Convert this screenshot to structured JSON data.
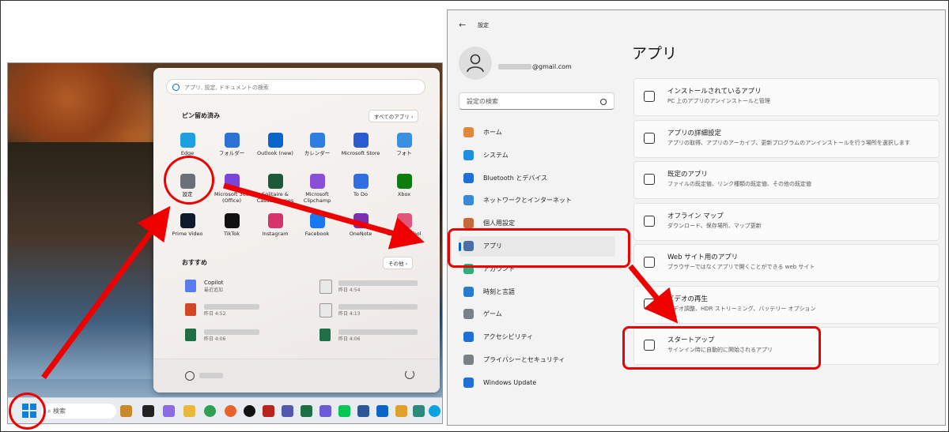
{
  "start_menu": {
    "search_placeholder": "アプリ, 設定, ドキュメントの検索",
    "pinned_heading": "ピン留め済み",
    "all_apps_label": "すべてのアプリ ›",
    "pinned_apps": [
      {
        "label": "Edge",
        "color": "#1ea0e0"
      },
      {
        "label": "フォルダー",
        "color": "#2a72d3"
      },
      {
        "label": "Outlook (new)",
        "color": "#0a64c9"
      },
      {
        "label": "カレンダー",
        "color": "#2f7de1"
      },
      {
        "label": "Microsoft Store",
        "color": "#2a5cd0"
      },
      {
        "label": "フォト",
        "color": "#3b8fe0"
      },
      {
        "label": "設定",
        "color": "#6b6f78"
      },
      {
        "label": "Microsoft 365 (Office)",
        "color": "#7b45d6"
      },
      {
        "label": "Solitaire & Casual Games",
        "color": "#1d5a3a"
      },
      {
        "label": "Microsoft Clipchamp",
        "color": "#8a4fd8"
      },
      {
        "label": "To Do",
        "color": "#2f6fe0"
      },
      {
        "label": "Xbox",
        "color": "#107c10"
      },
      {
        "label": "Prime Video",
        "color": "#0f1b2d"
      },
      {
        "label": "TikTok",
        "color": "#111111"
      },
      {
        "label": "Instagram",
        "color": "#d6336c"
      },
      {
        "label": "Facebook",
        "color": "#1877f2"
      },
      {
        "label": "OneNote",
        "color": "#7b2fb0"
      },
      {
        "label": "Snipping Tool",
        "color": "#e0567a"
      }
    ],
    "recommended_heading": "おすすめ",
    "more_label": "その他 ›",
    "recommended": [
      {
        "title": "Copilot",
        "sub": "最近追加",
        "color": "#5b7cf0"
      },
      {
        "title": "",
        "sub": "昨日 4:54",
        "color": "#e8e8e8"
      },
      {
        "title": "",
        "sub": "昨日 4:52",
        "color": "#d24726"
      },
      {
        "title": "",
        "sub": "昨日 4:13",
        "color": "#e8e8e8"
      },
      {
        "title": "",
        "sub": "昨日 4:06",
        "color": "#1d7044"
      },
      {
        "title": "",
        "sub": "昨日 4:06",
        "color": "#1d7044"
      }
    ]
  },
  "taskbar": {
    "search_placeholder": "検索"
  },
  "settings": {
    "window_title": "設定",
    "email": "@gmail.com",
    "search_placeholder": "設定の検索",
    "page_title": "アプリ",
    "nav": [
      {
        "label": "ホーム",
        "icon": "home-icon",
        "color": "#e0883c"
      },
      {
        "label": "システム",
        "icon": "system-icon",
        "color": "#1e8fe0"
      },
      {
        "label": "Bluetooth とデバイス",
        "icon": "bluetooth-icon",
        "color": "#1e6fd8"
      },
      {
        "label": "ネットワークとインターネット",
        "icon": "network-icon",
        "color": "#3b87dc"
      },
      {
        "label": "個人用設定",
        "icon": "personalization-icon",
        "color": "#c46a3a"
      },
      {
        "label": "アプリ",
        "icon": "apps-icon",
        "color": "#4a6fa5"
      },
      {
        "label": "アカウント",
        "icon": "account-icon",
        "color": "#2fae7a"
      },
      {
        "label": "時刻と言語",
        "icon": "time-language-icon",
        "color": "#2a7bd0"
      },
      {
        "label": "ゲーム",
        "icon": "gaming-icon",
        "color": "#7a8088"
      },
      {
        "label": "アクセシビリティ",
        "icon": "accessibility-icon",
        "color": "#1e6fd8"
      },
      {
        "label": "プライバシーとセキュリティ",
        "icon": "privacy-icon",
        "color": "#7a8088"
      },
      {
        "label": "Windows Update",
        "icon": "windows-update-icon",
        "color": "#1e6fd8"
      }
    ],
    "cards": [
      {
        "title": "インストールされているアプリ",
        "desc": "PC 上のアプリのアンインストールと管理",
        "icon": "installed-apps-icon"
      },
      {
        "title": "アプリの詳細設定",
        "desc": "アプリの取得、アプリのアーカイブ、更新プログラムのアンインストールを行う場所を選択します",
        "icon": "advanced-app-settings-icon"
      },
      {
        "title": "既定のアプリ",
        "desc": "ファイルの既定値、リンク種類の既定値、その他の既定値",
        "icon": "default-apps-icon"
      },
      {
        "title": "オフライン マップ",
        "desc": "ダウンロード、保存場所、マップ更新",
        "icon": "offline-maps-icon"
      },
      {
        "title": "Web サイト用のアプリ",
        "desc": "ブラウザーではなくアプリで開くことができる web サイト",
        "icon": "apps-for-websites-icon"
      },
      {
        "title": "ビデオの再生",
        "desc": "ビデオ調整、HDR ストリーミング、バッテリー オプション",
        "icon": "video-playback-icon"
      },
      {
        "title": "スタートアップ",
        "desc": "サインイン時に自動的に開始されるアプリ",
        "icon": "startup-icon"
      }
    ]
  },
  "colors": {
    "annotation": "#e00000",
    "accent": "#0067c0"
  }
}
